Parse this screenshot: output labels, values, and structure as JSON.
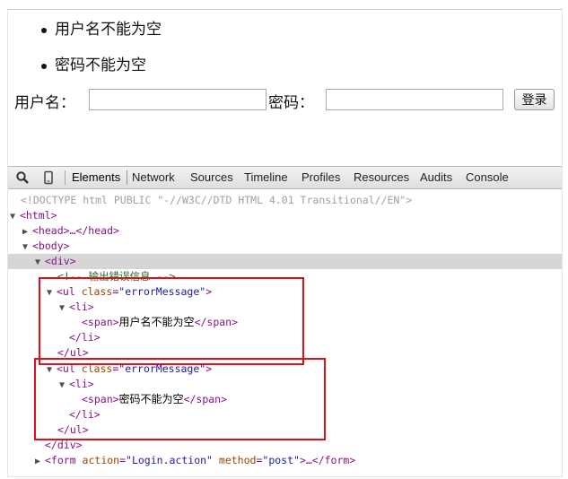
{
  "page": {
    "errors": [
      "用户名不能为空",
      "密码不能为空"
    ],
    "username_label": "用户名：",
    "password_label": "密码：",
    "login_button": "登录",
    "username_value": "",
    "password_value": ""
  },
  "devtools": {
    "tabs": [
      "Elements",
      "Network",
      "Sources",
      "Timeline",
      "Profiles",
      "Resources",
      "Audits",
      "Console"
    ],
    "active_tab": "Elements",
    "lines": {
      "doctype": "<!DOCTYPE html PUBLIC \"-//W3C//DTD HTML 4.01 Transitional//EN\">",
      "html_open": "<html>",
      "head": "<head>…</head>",
      "body_open": "<body>",
      "div_open": "<div>",
      "comment": "<!--   输出错误信息    -->",
      "ul_open": "<ul ",
      "class_attr": "class",
      "class_val": "\"errorMessage\"",
      "li_open": "<li>",
      "span_open": "<span>",
      "span_close": "</span>",
      "error_1": "用户名不能为空",
      "error_2": "密码不能为空",
      "li_close": "</li>",
      "ul_close": "</ul>",
      "div_close": "</div>",
      "form_open": "<form ",
      "action_attr": "action",
      "action_val": "\"Login.action\"",
      "method_attr": "method",
      "method_val": "\"post\"",
      "form_rest": ">…</form>"
    }
  },
  "colors": {
    "highlight_border": "#e0101a",
    "tag": "#881280",
    "attribute": "#994500",
    "attribute_value": "#1a1aa6",
    "selected_row": "#d6d6d6"
  }
}
